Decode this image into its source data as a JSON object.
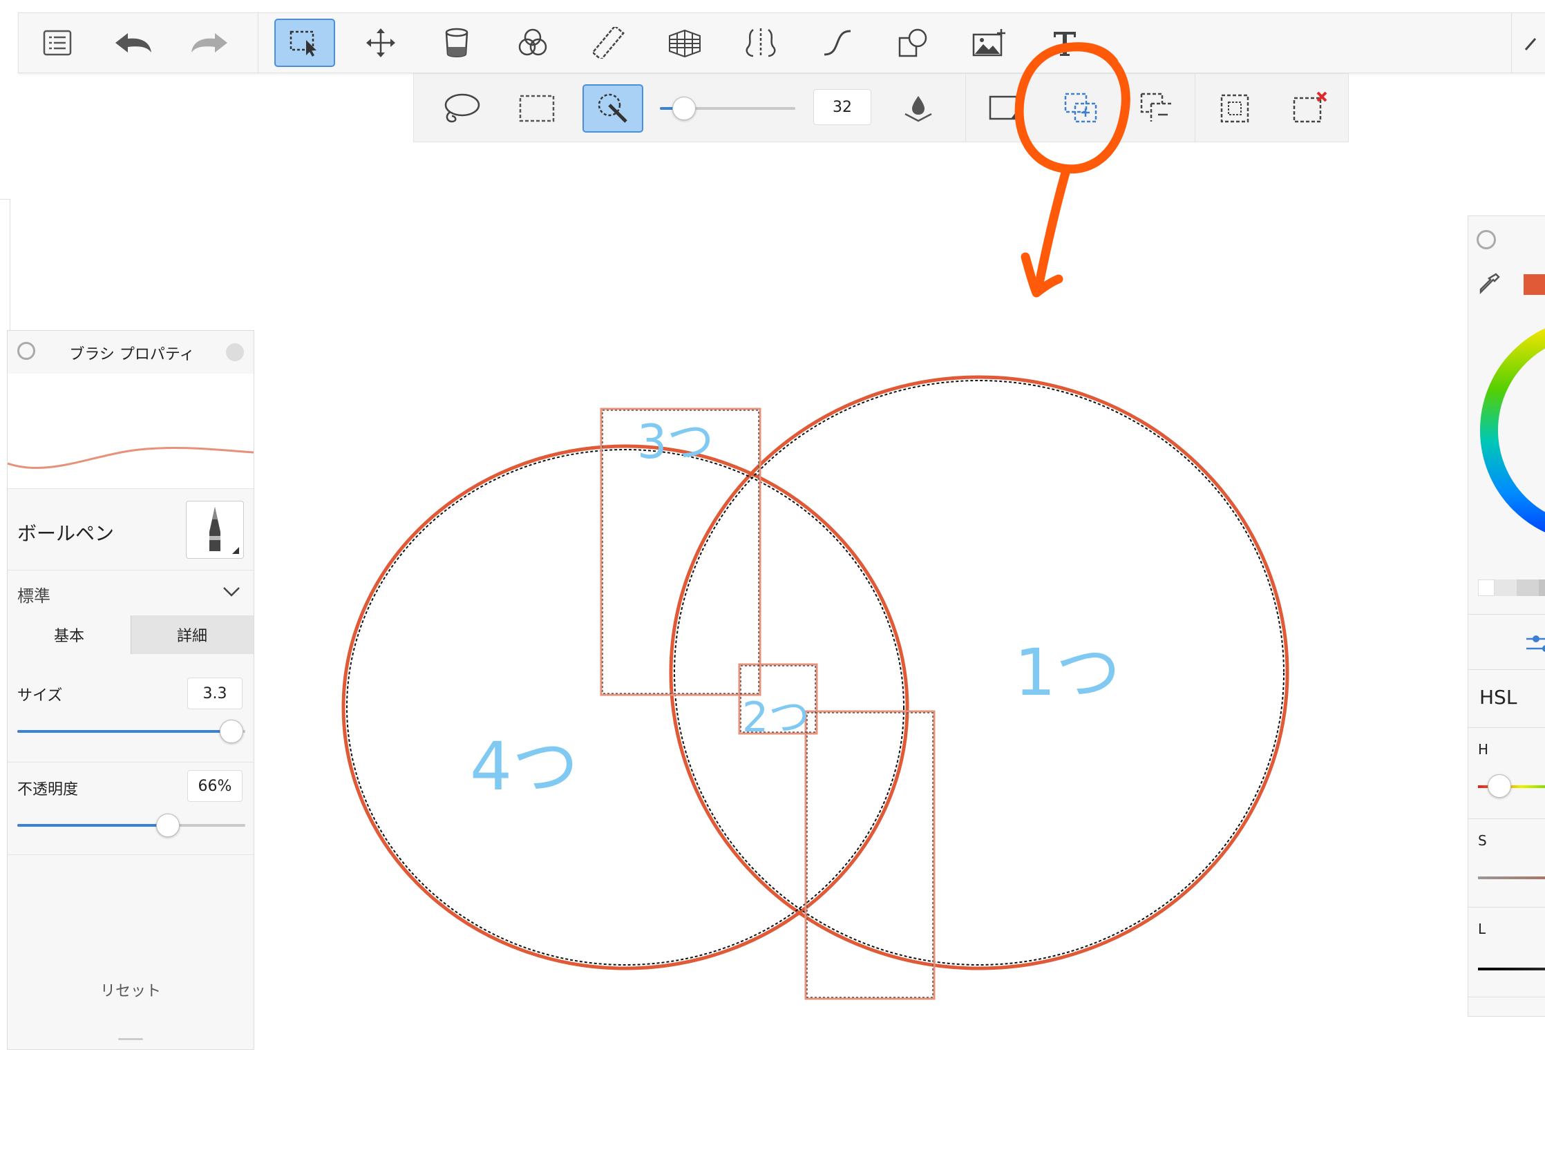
{
  "toolbar": {
    "tools": [
      {
        "name": "menu-list-icon"
      },
      {
        "name": "undo-icon"
      },
      {
        "name": "redo-icon"
      },
      {
        "name": "selection-tool-icon",
        "active": true
      },
      {
        "name": "move-transform-icon"
      },
      {
        "name": "fill-bucket-icon"
      },
      {
        "name": "blend-layers-icon"
      },
      {
        "name": "ruler-icon"
      },
      {
        "name": "perspective-grid-icon"
      },
      {
        "name": "symmetry-icon"
      },
      {
        "name": "curve-icon"
      },
      {
        "name": "shape-icon"
      },
      {
        "name": "add-image-icon"
      },
      {
        "name": "text-icon"
      }
    ]
  },
  "selection_toolbar": {
    "tools": [
      "lasso-select-icon",
      "rect-select-icon",
      "magic-wand-icon"
    ],
    "active_tool": "magic-wand-icon",
    "tolerance_fraction": 0.18,
    "tolerance_value": "32",
    "modes": [
      "new-selection-icon",
      "add-selection-icon",
      "subtract-selection-icon",
      "select-inverse-icon",
      "clear-selection-icon"
    ]
  },
  "brush_panel": {
    "title": "ブラシ プロパティ",
    "brush_name": "ボールペン",
    "blend_mode": "標準",
    "tabs": [
      "基本",
      "詳細"
    ],
    "active_tab": "基本",
    "size_label": "サイズ",
    "size_value": "3.3",
    "size_fraction": 0.94,
    "opacity_label": "不透明度",
    "opacity_value": "66%",
    "opacity_fraction": 0.66,
    "reset_label": "リセット"
  },
  "color_panel": {
    "model": "HSL",
    "channels": [
      "H",
      "S",
      "L"
    ],
    "current_color": "#e05a38"
  },
  "canvas": {
    "annotations": [
      "1つ",
      "2つ",
      "3つ",
      "4つ"
    ],
    "stroke_color": "#e05a38",
    "annotation_color": "#7fc9f2",
    "highlight_color": "#ff5a0a"
  }
}
